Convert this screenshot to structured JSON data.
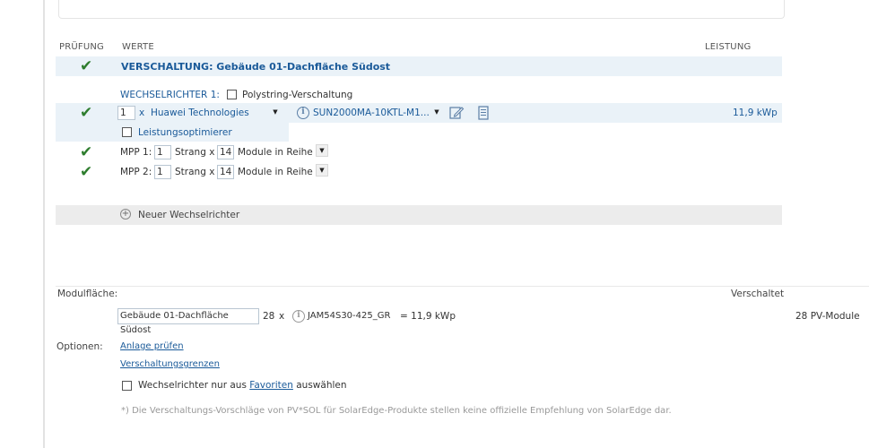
{
  "header": {
    "pruefung": "PRÜFUNG",
    "werte": "WERTE",
    "leistung": "LEISTUNG"
  },
  "verschaltung": {
    "title": "VERSCHALTUNG: Gebäude 01-Dachfläche Südost"
  },
  "inverter": {
    "label": "WECHSELRICHTER 1:",
    "polystring_label": "Polystring-Verschaltung",
    "count": "1",
    "x": "x",
    "manufacturer": "Huawei Technologies",
    "model": "SUN2000MA-10KTL-M1...",
    "power": "11,9 kWp",
    "optimizer_label": "Leistungsoptimierer"
  },
  "mpp": [
    {
      "label": "MPP 1:",
      "strings": "1",
      "strang": "Strang x",
      "modules": "14",
      "suffix": "Module in Reihe"
    },
    {
      "label": "MPP 2:",
      "strings": "1",
      "strang": "Strang x",
      "modules": "14",
      "suffix": "Module in Reihe"
    }
  ],
  "new_inverter": {
    "label": "Neuer Wechselrichter"
  },
  "module_area": {
    "label": "Modulfläche:",
    "connected_label": "Verschaltet",
    "area_name": "Gebäude 01-Dachfläche Südost",
    "count": "28",
    "x": "x",
    "module_type": "JAM54S30-425_GR",
    "equals": "= 11,9 kWp",
    "pv_modules": "28 PV-Module"
  },
  "options": {
    "label": "Optionen:",
    "check_link": "Anlage prüfen",
    "limits_link": "Verschaltungsgrenzen",
    "favorites_prefix": "Wechselrichter nur aus",
    "favorites_link": "Favoriten",
    "favorites_suffix": "auswählen"
  },
  "footnote": "*) Die Verschaltungs-Vorschläge von PV*SOL für SolarEdge-Produkte stellen keine offizielle Empfehlung von SolarEdge dar.",
  "colors": {
    "accent": "#1a5a99",
    "check": "#2e7d2e",
    "band": "#eaf2f8",
    "grey_band": "#ececec"
  }
}
